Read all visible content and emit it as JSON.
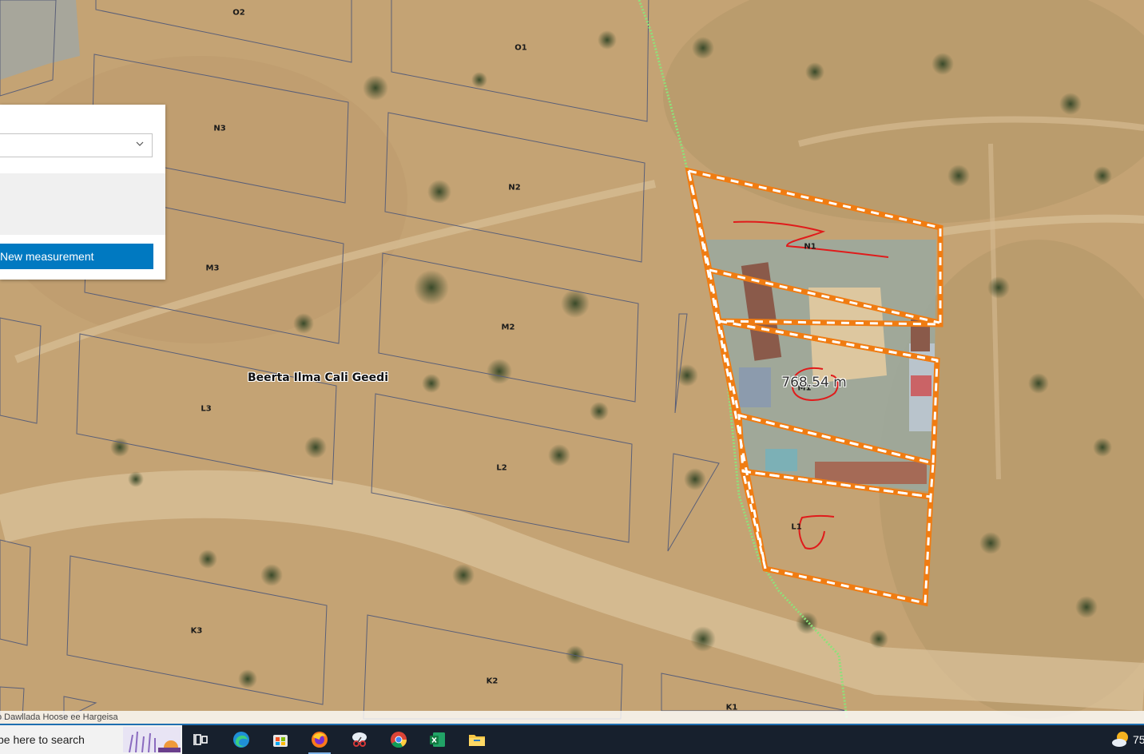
{
  "map": {
    "place_label": "Beerta Ilma Cali Geedi",
    "measurement_value": "768.54 m",
    "parcel_labels": [
      {
        "id": "O2",
        "text": "O2"
      },
      {
        "id": "O1",
        "text": "O1"
      },
      {
        "id": "N3",
        "text": "N3"
      },
      {
        "id": "N2",
        "text": "N2"
      },
      {
        "id": "N1",
        "text": "N1"
      },
      {
        "id": "M3",
        "text": "M3"
      },
      {
        "id": "M2",
        "text": "M2"
      },
      {
        "id": "M1",
        "text": "M1"
      },
      {
        "id": "L3",
        "text": "L3"
      },
      {
        "id": "L2",
        "text": "L2"
      },
      {
        "id": "L1",
        "text": "L1"
      },
      {
        "id": "K3",
        "text": "K3"
      },
      {
        "id": "K2",
        "text": "K2"
      },
      {
        "id": "K1",
        "text": "K1"
      }
    ],
    "colors": {
      "measure_line": "#f07c12",
      "measure_dash": "#ffffff",
      "parcel_outline": "#5a5f78",
      "boundary_line": "#8fe07a",
      "annotation": "#e01b1b"
    }
  },
  "widget": {
    "unit_select_value": "",
    "new_measurement_label": "New measurement",
    "button_color": "#0079c1"
  },
  "attribution": {
    "text": "o Dawllada Hoose ee Hargeisa"
  },
  "taskbar": {
    "search_text": "pe here to search",
    "icons": [
      "task-view-icon",
      "edge-icon",
      "store-icon",
      "firefox-icon",
      "snipping-tool-icon",
      "chrome-icon",
      "excel-icon",
      "file-explorer-icon"
    ],
    "active_icon": "firefox-icon",
    "weather_temp": "75"
  }
}
